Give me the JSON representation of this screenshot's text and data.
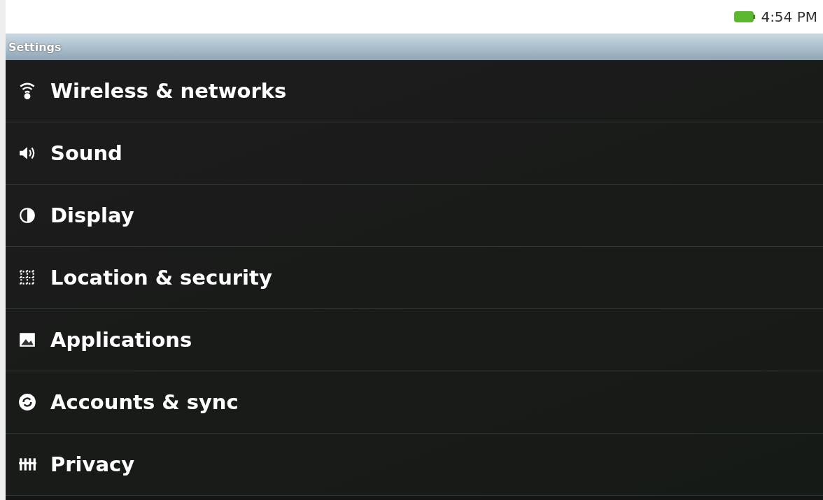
{
  "status_bar": {
    "time": "4:54 PM"
  },
  "title_bar": {
    "title": "Settings"
  },
  "items": [
    {
      "label": "Wireless & networks"
    },
    {
      "label": "Sound"
    },
    {
      "label": "Display"
    },
    {
      "label": "Location & security"
    },
    {
      "label": "Applications"
    },
    {
      "label": "Accounts & sync"
    },
    {
      "label": "Privacy"
    }
  ]
}
